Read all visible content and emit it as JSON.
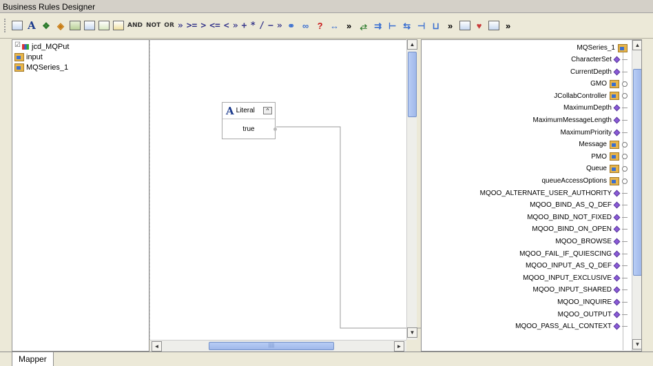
{
  "window": {
    "title": "Business Rules Designer"
  },
  "toolbar": {
    "logic_items": [
      "AND",
      "NOT",
      "OR"
    ],
    "operators": [
      "»",
      ">=",
      ">",
      "<=",
      "<",
      "»",
      "+",
      "*",
      "/",
      "−",
      "»"
    ],
    "icon_names": [
      "method-icon",
      "literal-icon",
      "class-icon",
      "constructor-icon",
      "array-icon",
      "cast-icon",
      "var-icon",
      "reset-icon"
    ]
  },
  "left_tree": {
    "items": [
      {
        "label": "jcd_MQPut",
        "icon": "jcd-icon"
      },
      {
        "label": "input",
        "icon": "folder-icon"
      },
      {
        "label": "MQSeries_1",
        "icon": "folder-icon"
      }
    ]
  },
  "literal": {
    "header": "Literal",
    "value": "true",
    "collapse_glyph": "^"
  },
  "right_tree": {
    "root": "MQSeries_1",
    "items": [
      {
        "label": "CharacterSet",
        "kind": "field"
      },
      {
        "label": "CurrentDepth",
        "kind": "field"
      },
      {
        "label": "GMO",
        "kind": "node"
      },
      {
        "label": "JCollabController",
        "kind": "node"
      },
      {
        "label": "MaximumDepth",
        "kind": "field"
      },
      {
        "label": "MaximumMessageLength",
        "kind": "field"
      },
      {
        "label": "MaximumPriority",
        "kind": "field"
      },
      {
        "label": "Message",
        "kind": "node"
      },
      {
        "label": "PMO",
        "kind": "node"
      },
      {
        "label": "Queue",
        "kind": "node"
      },
      {
        "label": "queueAccessOptions",
        "kind": "node"
      },
      {
        "label": "MQOO_ALTERNATE_USER_AUTHORITY",
        "kind": "field"
      },
      {
        "label": "MQOO_BIND_AS_Q_DEF",
        "kind": "field"
      },
      {
        "label": "MQOO_BIND_NOT_FIXED",
        "kind": "field"
      },
      {
        "label": "MQOO_BIND_ON_OPEN",
        "kind": "field"
      },
      {
        "label": "MQOO_BROWSE",
        "kind": "field"
      },
      {
        "label": "MQOO_FAIL_IF_QUIESCING",
        "kind": "field"
      },
      {
        "label": "MQOO_INPUT_AS_Q_DEF",
        "kind": "field"
      },
      {
        "label": "MQOO_INPUT_EXCLUSIVE",
        "kind": "field"
      },
      {
        "label": "MQOO_INPUT_SHARED",
        "kind": "field"
      },
      {
        "label": "MQOO_INQUIRE",
        "kind": "field"
      },
      {
        "label": "MQOO_OUTPUT",
        "kind": "field"
      },
      {
        "label": "MQOO_PASS_ALL_CONTEXT",
        "kind": "field"
      }
    ]
  },
  "tabs": {
    "mapper": "Mapper"
  },
  "scroll": {
    "canvas_h": {
      "left": "◄",
      "right": "►",
      "grip": "|||||"
    },
    "canvas_v": {
      "up": "▲",
      "down": "▼"
    },
    "right_v": {
      "up": "▲",
      "down": "▼"
    }
  }
}
